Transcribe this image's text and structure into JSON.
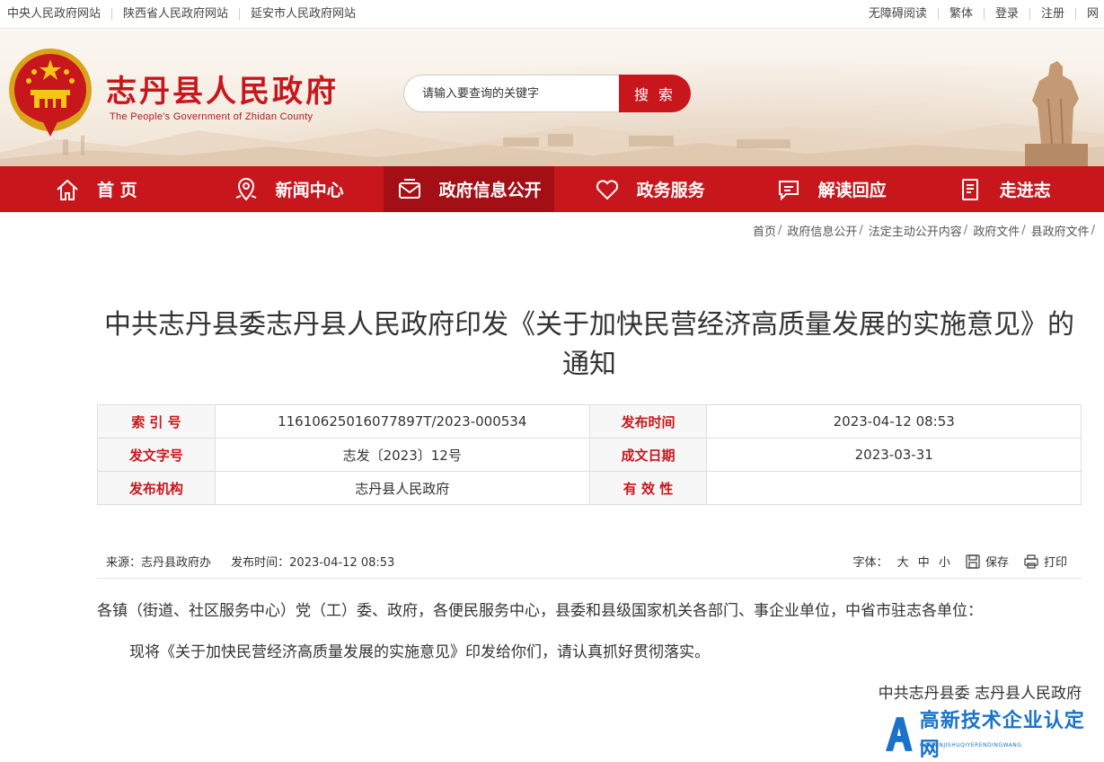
{
  "topbar": {
    "left_links": [
      "中央人民政府网站",
      "陕西省人民政府网站",
      "延安市人民政府网站"
    ],
    "right_links": [
      "无障碍阅读",
      "繁体",
      "登录",
      "注册",
      "网"
    ]
  },
  "header": {
    "site_title": "志丹县人民政府",
    "site_subtitle": "The People's Government of Zhidan County",
    "search_placeholder": "请输入要查询的关键字",
    "search_button": "搜 索"
  },
  "nav": {
    "items": [
      {
        "label": "首 页",
        "icon": "home-icon"
      },
      {
        "label": "新闻中心",
        "icon": "location-pin-icon"
      },
      {
        "label": "政府信息公开",
        "icon": "envelope-icon"
      },
      {
        "label": "政务服务",
        "icon": "heart-icon"
      },
      {
        "label": "解读回应",
        "icon": "chat-icon"
      },
      {
        "label": "走进志",
        "icon": "news-icon"
      }
    ],
    "active_index": 2
  },
  "breadcrumb": [
    "首页",
    "政府信息公开",
    "法定主动公开内容",
    "政府文件",
    "县政府文件"
  ],
  "article": {
    "title": "中共志丹县委志丹县人民政府印发《关于加快民营经济高质量发展的实施意见》的通知",
    "info": {
      "index_label": "索 引 号",
      "index_value": "11610625016077897T/2023-000534",
      "publish_time_label": "发布时间",
      "publish_time_value": "2023-04-12 08:53",
      "doc_no_label": "发文字号",
      "doc_no_value": "志发〔2023〕12号",
      "written_date_label": "成文日期",
      "written_date_value": "2023-03-31",
      "issuer_label": "发布机构",
      "issuer_value": "志丹县人民政府",
      "validity_label": "有 效 性",
      "validity_value": ""
    },
    "meta": {
      "source": "来源：志丹县政府办",
      "publish": "发布时间：2023-04-12 08:53",
      "font_label": "字体：",
      "font_large": "大",
      "font_medium": "中",
      "font_small": "小",
      "save": "保存",
      "print": "打印"
    },
    "paragraph1": "各镇（街道、社区服务中心）党（工）委、政府，各便民服务中心，县委和县级国家机关各部门、事企业单位，中省市驻志各单位：",
    "paragraph2": "现将《关于加快民营经济高质量发展的实施意见》印发给你们，请认真抓好贯彻落实。",
    "signature": "中共志丹县委 志丹县人民政府"
  },
  "watermark": {
    "text": "高新技术企业认定网",
    "sub": "GAOXINJISHUQIYERENDINGWANG"
  },
  "colors": {
    "brand_red": "#c8161d",
    "nav_active": "#a30f15"
  }
}
